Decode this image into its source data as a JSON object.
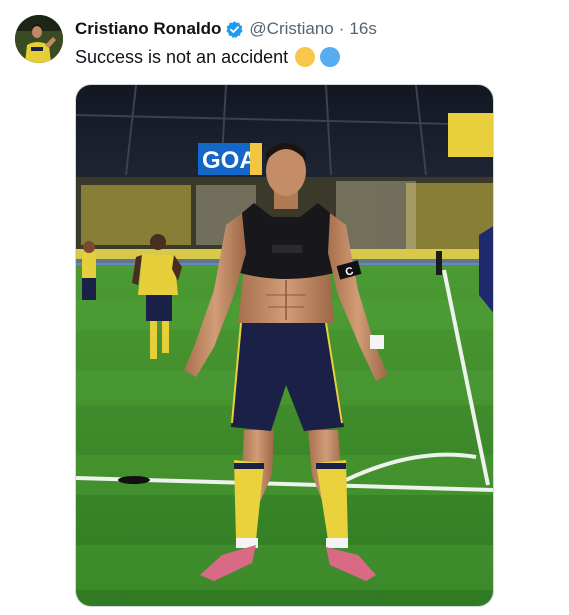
{
  "tweet": {
    "author_name": "Cristiano Ronaldo",
    "handle": "@Cristiano",
    "separator": "·",
    "time": "16s",
    "text": "Success is not an accident",
    "emojis": [
      "#f7c64b",
      "#55acee"
    ],
    "verified": true
  },
  "photo": {
    "scoreboard_text": "GOA",
    "captain_band_text": "C"
  },
  "colors": {
    "accent_blue": "#1d9bf0",
    "text_primary": "#0f1419",
    "text_secondary": "#536471",
    "pitch_green": "#3f8a2a",
    "kit_yellow": "#e9d23b",
    "kit_navy": "#1a2046"
  },
  "icons": {
    "verified": "verified-badge-icon"
  }
}
